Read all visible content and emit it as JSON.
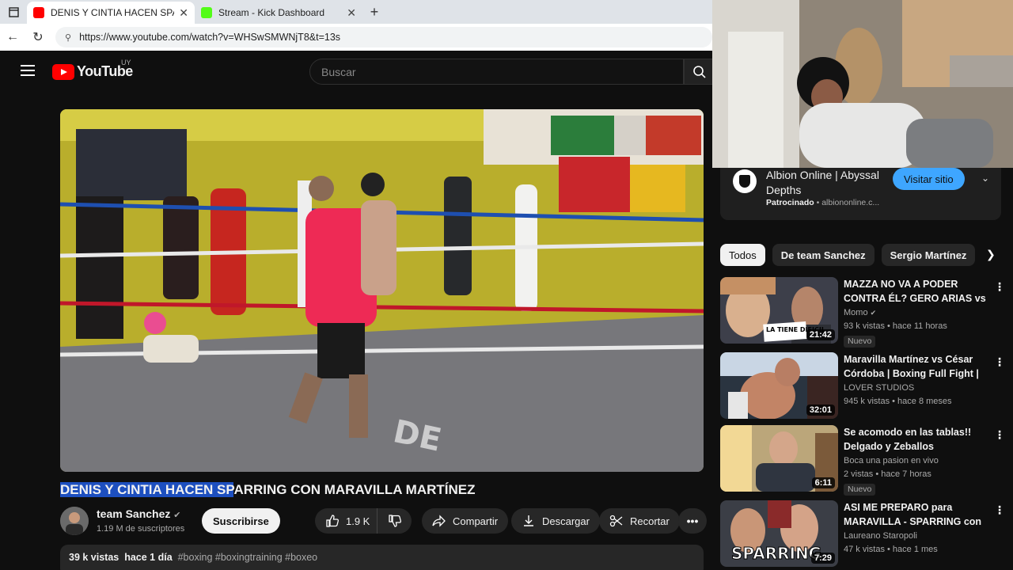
{
  "browser": {
    "tabs": [
      {
        "title": "DENIS Y CINTIA HACEN SPARRING",
        "active": true
      },
      {
        "title": "Stream - Kick Dashboard",
        "active": false
      }
    ],
    "url": "https://www.youtube.com/watch?v=WHSwSMWNjT8&t=13s"
  },
  "youtube": {
    "logo_text": "YouTube",
    "country_code": "UY",
    "search_placeholder": "Buscar"
  },
  "video": {
    "title_selected": "DENIS Y CINTIA HACEN SP",
    "title_rest": "ARRING CON MARAVILLA MARTÍNEZ",
    "channel": "team Sanchez",
    "subscribers": "1.19 M de suscriptores",
    "subscribe_label": "Suscribirse",
    "likes": "1.9 K",
    "share_label": "Compartir",
    "download_label": "Descargar",
    "clip_label": "Recortar",
    "views": "39 k vistas",
    "age": "hace 1 día",
    "tags": "#boxing #boxingtraining #boxeo"
  },
  "ad": {
    "title": "Albion Online | Abyssal Depths",
    "sponsored": "Patrocinado",
    "domain": "albiononline.c...",
    "visit_label": "Visitar sitio"
  },
  "chips": [
    "Todos",
    "De team Sanchez",
    "Sergio Martínez"
  ],
  "recommendations": [
    {
      "title": "MAZZA NO VA A PODER CONTRA ÉL? GERO ARIAS vs ...",
      "channel": "Momo",
      "meta": "93 k vistas • hace 11 horas",
      "duration": "21:42",
      "badge": "Nuevo"
    },
    {
      "title": "Maravilla Martínez vs César Córdoba | Boxing Full Fight | ...",
      "channel": "LOVER STUDIOS",
      "meta": "945 k vistas • hace 8 meses",
      "duration": "32:01",
      "badge": ""
    },
    {
      "title": "Se acomodo en las tablas!! Delgado y Zeballos",
      "channel": "Boca una pasion en vivo",
      "meta": "2 vistas • hace 7 horas",
      "duration": "6:11",
      "badge": "Nuevo"
    },
    {
      "title": "ASI ME PREPARO para MARAVILLA - SPARRING con l...",
      "channel": "Laureano Staropoli",
      "meta": "47 k vistas • hace 1 mes",
      "duration": "7:29",
      "badge": ""
    }
  ],
  "thumb_texts": {
    "t1": "LA TIENE DIFICIL",
    "t4": "SPARRING"
  },
  "colors": {
    "accent_red": "#ff0000",
    "visit_blue": "#3ea6ff",
    "selection": "#1d4fbf"
  }
}
